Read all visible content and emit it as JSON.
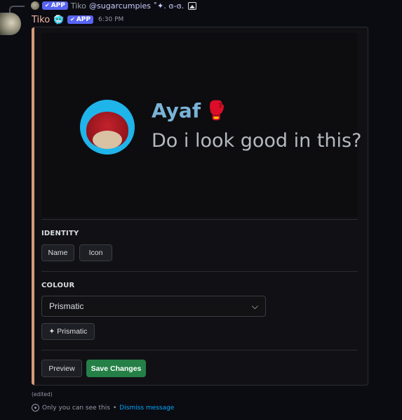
{
  "reply": {
    "badge": "APP",
    "author": "Tiko",
    "handle": "@sugarcumpies ˚✦. ɞ-ɞ."
  },
  "message": {
    "author": "Tiko",
    "bot_emoji": "🥶",
    "badge": "APP",
    "timestamp": "6:30 PM",
    "edited": "(edited)",
    "ephemeral_text": "Only you can see this",
    "separator": " • ",
    "dismiss_label": "Dismiss message"
  },
  "preview": {
    "name": "Ayaf",
    "name_emoji": "🥊",
    "text": "Do i look good in this?"
  },
  "identity": {
    "label": "IDENTITY",
    "name_button": "Name",
    "icon_button": "Icon"
  },
  "colour": {
    "label": "COLOUR",
    "selected": "Prismatic",
    "chip": "✦ Prismatic"
  },
  "actions": {
    "preview": "Preview",
    "save": "Save Changes"
  },
  "colors": {
    "accent_bar": "#d69a78",
    "author": "#f0b7a4",
    "preview_name": "#7ab3d6",
    "save": "#248046",
    "app_badge": "#5865f2",
    "link": "#00a8fc"
  }
}
